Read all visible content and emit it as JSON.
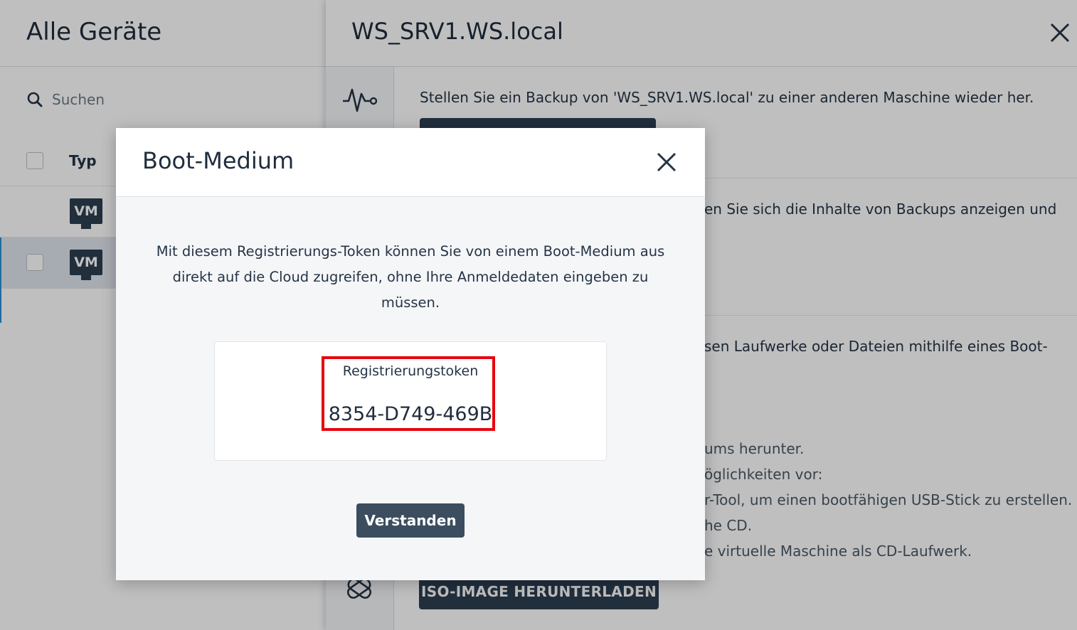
{
  "left_panel": {
    "title": "Alle Geräte",
    "search_placeholder": "Suchen",
    "column_type": "Typ",
    "rows": [
      {
        "badge": "VM"
      },
      {
        "badge": "VM"
      }
    ]
  },
  "right_panel": {
    "title": "WS_SRV1.WS.local",
    "section1_text": "Stellen Sie ein Backup von 'WS_SRV1.WS.local' zu einer anderen Maschine wieder her.",
    "section2_text": "en Sie sich die Inhalte von Backups anzeigen und",
    "section3_text": "sen Laufwerke oder Dateien mithilfe eines Boot-",
    "steps": [
      "ums herunter.",
      "öglichkeiten vor:",
      "r-Tool, um einen bootfähigen USB-Stick zu erstellen.",
      "he CD.",
      "e virtuelle Maschine als CD-Laufwerk."
    ],
    "iso_button": "ISO-IMAGE HERUNTERLADEN"
  },
  "modal": {
    "title": "Boot-Medium",
    "description": "Mit diesem Registrierungs-Token können Sie von einem Boot-Medium aus direkt auf die Cloud zugreifen, ohne Ihre Anmeldedaten eingeben zu müssen.",
    "token_label": "Registrierungstoken",
    "token_value": "8354-D749-469B",
    "ok_button": "Verstanden"
  },
  "colors": {
    "accent_dark": "#2c3e50",
    "highlight_red": "#e8050e"
  }
}
